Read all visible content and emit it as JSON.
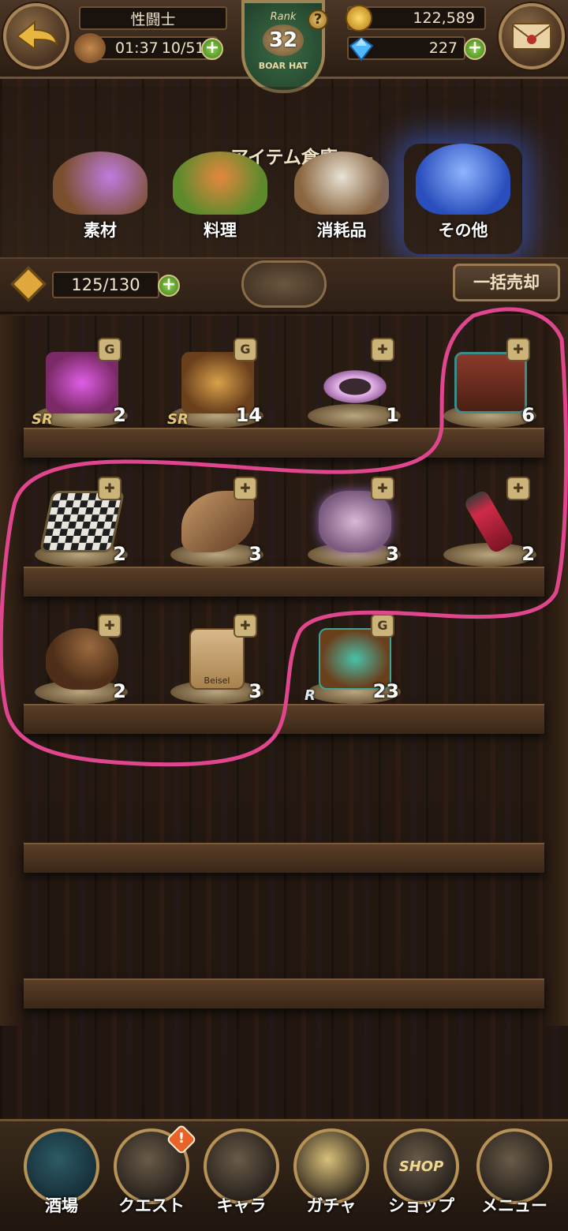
{
  "header": {
    "player_title": "性闘士",
    "stamina_timer": "01:37",
    "stamina": "10/51",
    "rank_label": "Rank",
    "rank_value": "32",
    "rank_sub": "BOAR HAT",
    "help_mark": "?",
    "gold": "122,589",
    "gems": "227",
    "plus_sign": "+"
  },
  "warehouse": {
    "title": "アイテム倉庫",
    "categories": [
      {
        "label": "素材",
        "icon": "materials-icon",
        "color": "#b46ad6"
      },
      {
        "label": "料理",
        "icon": "food-icon",
        "color": "#e07a3a"
      },
      {
        "label": "消耗品",
        "icon": "consumables-icon",
        "color": "#a78457"
      },
      {
        "label": "その他",
        "icon": "others-icon",
        "color": "#3f6fe6"
      }
    ],
    "capacity": "125/130",
    "bulk_sell": "一括売却"
  },
  "items": [
    {
      "count": "2",
      "badge": "G",
      "rarity": "SR",
      "icon": "treasure-chest-magic-icon",
      "color": "#b23fc4"
    },
    {
      "count": "14",
      "badge": "G",
      "rarity": "SR",
      "icon": "treasure-chest-icon",
      "color": "#8c5a2b"
    },
    {
      "count": "1",
      "badge": "✚",
      "rarity": "",
      "icon": "bracelet-icon",
      "color": "#d9a6e0"
    },
    {
      "count": "6",
      "badge": "✚",
      "rarity": "",
      "icon": "chess-set-box-icon",
      "color": "#7a3b2a"
    },
    {
      "count": "2",
      "badge": "✚",
      "rarity": "",
      "icon": "chessboard-icon",
      "color": "#cfcfcf"
    },
    {
      "count": "3",
      "badge": "✚",
      "rarity": "",
      "icon": "horn-icon",
      "color": "#9a6b43"
    },
    {
      "count": "3",
      "badge": "✚",
      "rarity": "",
      "icon": "rabbit-doll-icon",
      "color": "#c9a3c7"
    },
    {
      "count": "2",
      "badge": "✚",
      "rarity": "",
      "icon": "red-vial-icon",
      "color": "#c02a3f"
    },
    {
      "count": "2",
      "badge": "✚",
      "rarity": "",
      "icon": "coin-pouch-icon",
      "color": "#8a5a34"
    },
    {
      "count": "3",
      "badge": "✚",
      "rarity": "",
      "icon": "scroll-fist-icon",
      "color": "#c9a676",
      "caption": "Beisel"
    },
    {
      "count": "23",
      "badge": "G",
      "rarity": "R",
      "icon": "treasure-chest-green-icon",
      "color": "#3ea596"
    }
  ],
  "nav": [
    {
      "label": "酒場",
      "icon": "tavern-icon"
    },
    {
      "label": "クエスト",
      "icon": "quest-scroll-icon",
      "alert": "!"
    },
    {
      "label": "キャラ",
      "icon": "helmet-icon"
    },
    {
      "label": "ガチャ",
      "icon": "crystal-icon"
    },
    {
      "label": "ショップ",
      "icon": "shop-sign-icon",
      "sign": "SHOP"
    },
    {
      "label": "メニュー",
      "icon": "gear-icon"
    }
  ],
  "colors": {
    "annotation": "#e0468e",
    "accent_gold": "#d8b56b"
  }
}
